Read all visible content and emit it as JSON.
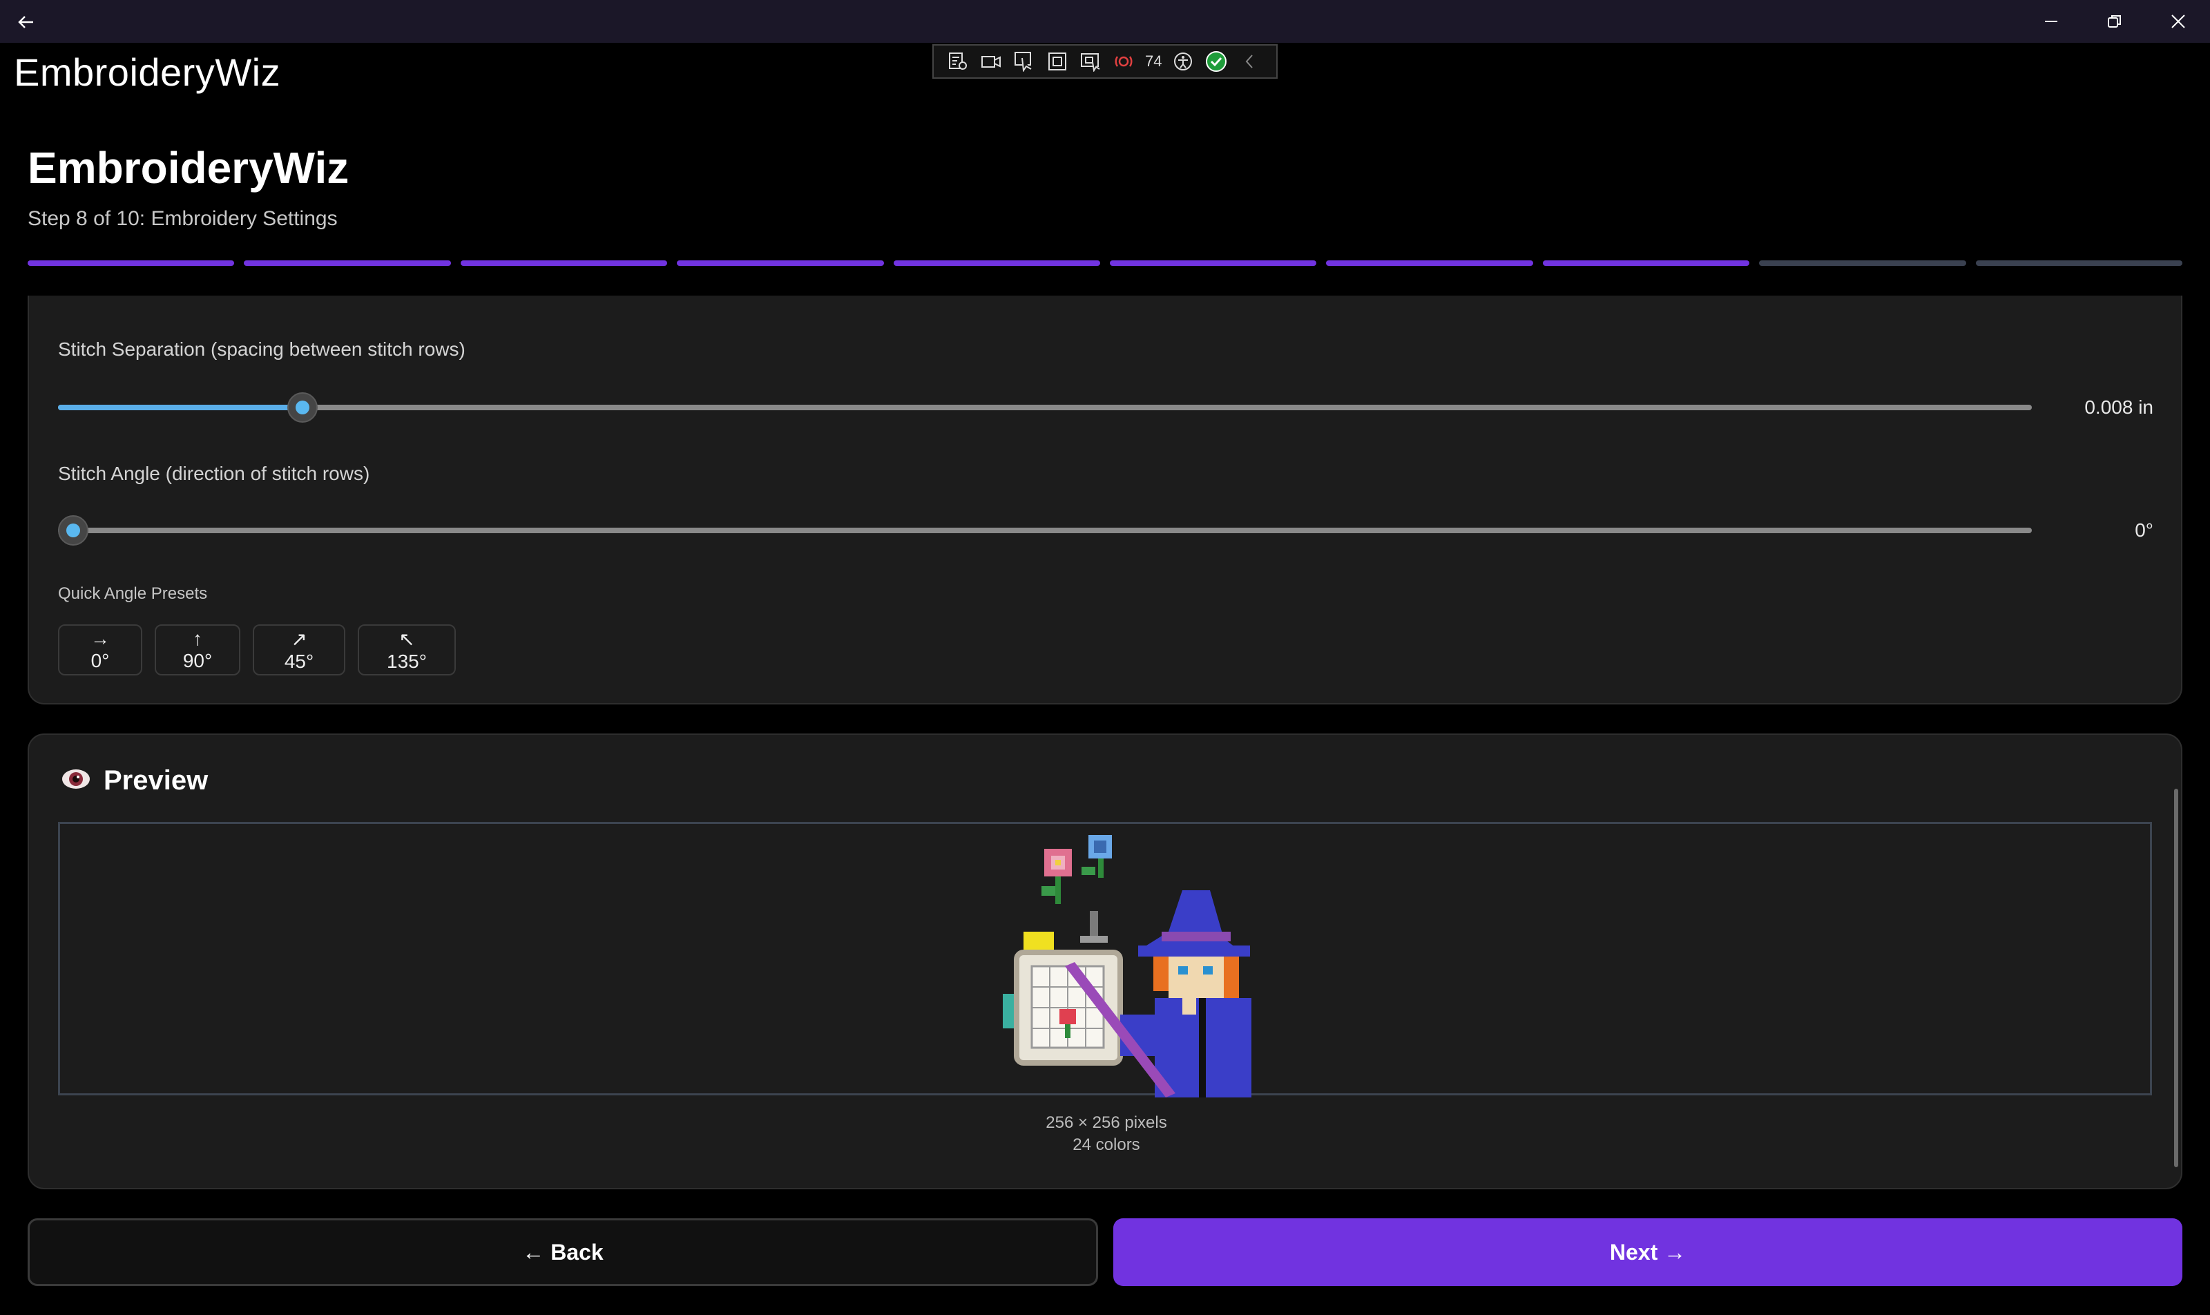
{
  "window": {
    "app_name": "EmbroideryWiz",
    "back_icon": "arrow-left-icon",
    "controls": [
      "minimize-icon",
      "restore-icon",
      "close-icon"
    ]
  },
  "debug_toolbar": {
    "icons": [
      "live-visual-tree-icon",
      "record-icon",
      "select-element-icon",
      "display-layout-adorners-icon",
      "track-focus-icon",
      "binding-failures-icon",
      "accessibility-icon",
      "hot-reload-check-icon",
      "collapse-chevron-icon"
    ],
    "binding_count": "74"
  },
  "header": {
    "title": "EmbroideryWiz",
    "step": "Step 8 of 10: Embroidery Settings",
    "progress": {
      "current": 8,
      "total": 10
    },
    "progress_color": "#7133e0"
  },
  "settings": {
    "separation": {
      "label": "Stitch Separation (spacing between stitch rows)",
      "value": "0.008 in",
      "fraction": 0.116
    },
    "angle": {
      "label": "Stitch Angle (direction of stitch rows)",
      "value": "0°",
      "fraction": 0.0
    },
    "presets_label": "Quick Angle Presets",
    "presets": [
      {
        "label": "→ 0°"
      },
      {
        "label": "↑ 90°"
      },
      {
        "label": "↗ 45°"
      },
      {
        "label": "↖ 135°"
      }
    ]
  },
  "preview": {
    "icon": "eye-icon",
    "title": "Preview",
    "dimensions": "256 × 256 pixels",
    "colors": "24 colors"
  },
  "nav": {
    "back": "← Back",
    "next": "Next →",
    "accent": "#7133e0"
  }
}
